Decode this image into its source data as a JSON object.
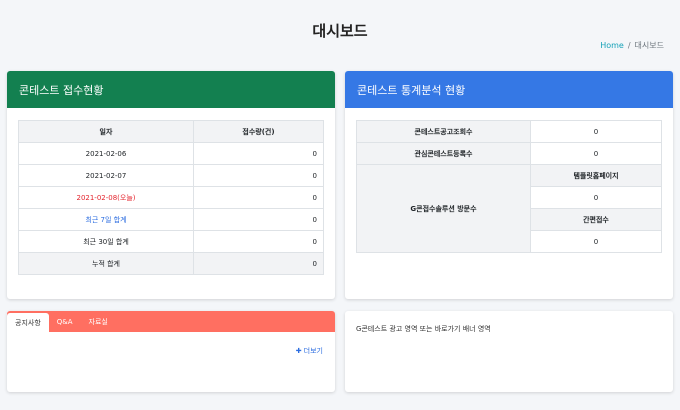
{
  "page": {
    "title": "대시보드"
  },
  "breadcrumb": {
    "home": "Home",
    "separator": "/",
    "current": "대시보드"
  },
  "contest_card": {
    "title": "콘테스트 접수현황",
    "header_color": "#138050",
    "columns": [
      "일자",
      "접수량(건)"
    ],
    "rows": [
      {
        "label": "2021-02-06",
        "value": "0"
      },
      {
        "label": "2021-02-07",
        "value": "0"
      },
      {
        "label": "2021-02-08(오늘)",
        "value": "0"
      },
      {
        "label": "최근 7일 합계",
        "value": "0"
      },
      {
        "label": "최근 30일 합계",
        "value": "0"
      },
      {
        "label": "누적 합계",
        "value": "0"
      }
    ]
  },
  "stats_card": {
    "title": "콘테스트 통계분석 현황",
    "header_color": "#3578e5",
    "rows": [
      {
        "label": "콘테스트공고조회수",
        "value": "0"
      },
      {
        "label": "관심콘테스트등록수",
        "value": "0"
      }
    ],
    "visitor": {
      "label": "G콘접수솔루션 방문수",
      "sub": [
        {
          "label": "템플릿홈페이지",
          "value": "0"
        },
        {
          "label": "간편접수",
          "value": "0"
        }
      ]
    }
  },
  "notice_card": {
    "tab_color": "#ff6f61",
    "tabs": [
      "공지사항",
      "Q&A",
      "자료실"
    ],
    "more_label": "더보기"
  },
  "banner_card": {
    "text": "G콘테스트 광고 영역 또는 바로가기 배너 영역"
  }
}
